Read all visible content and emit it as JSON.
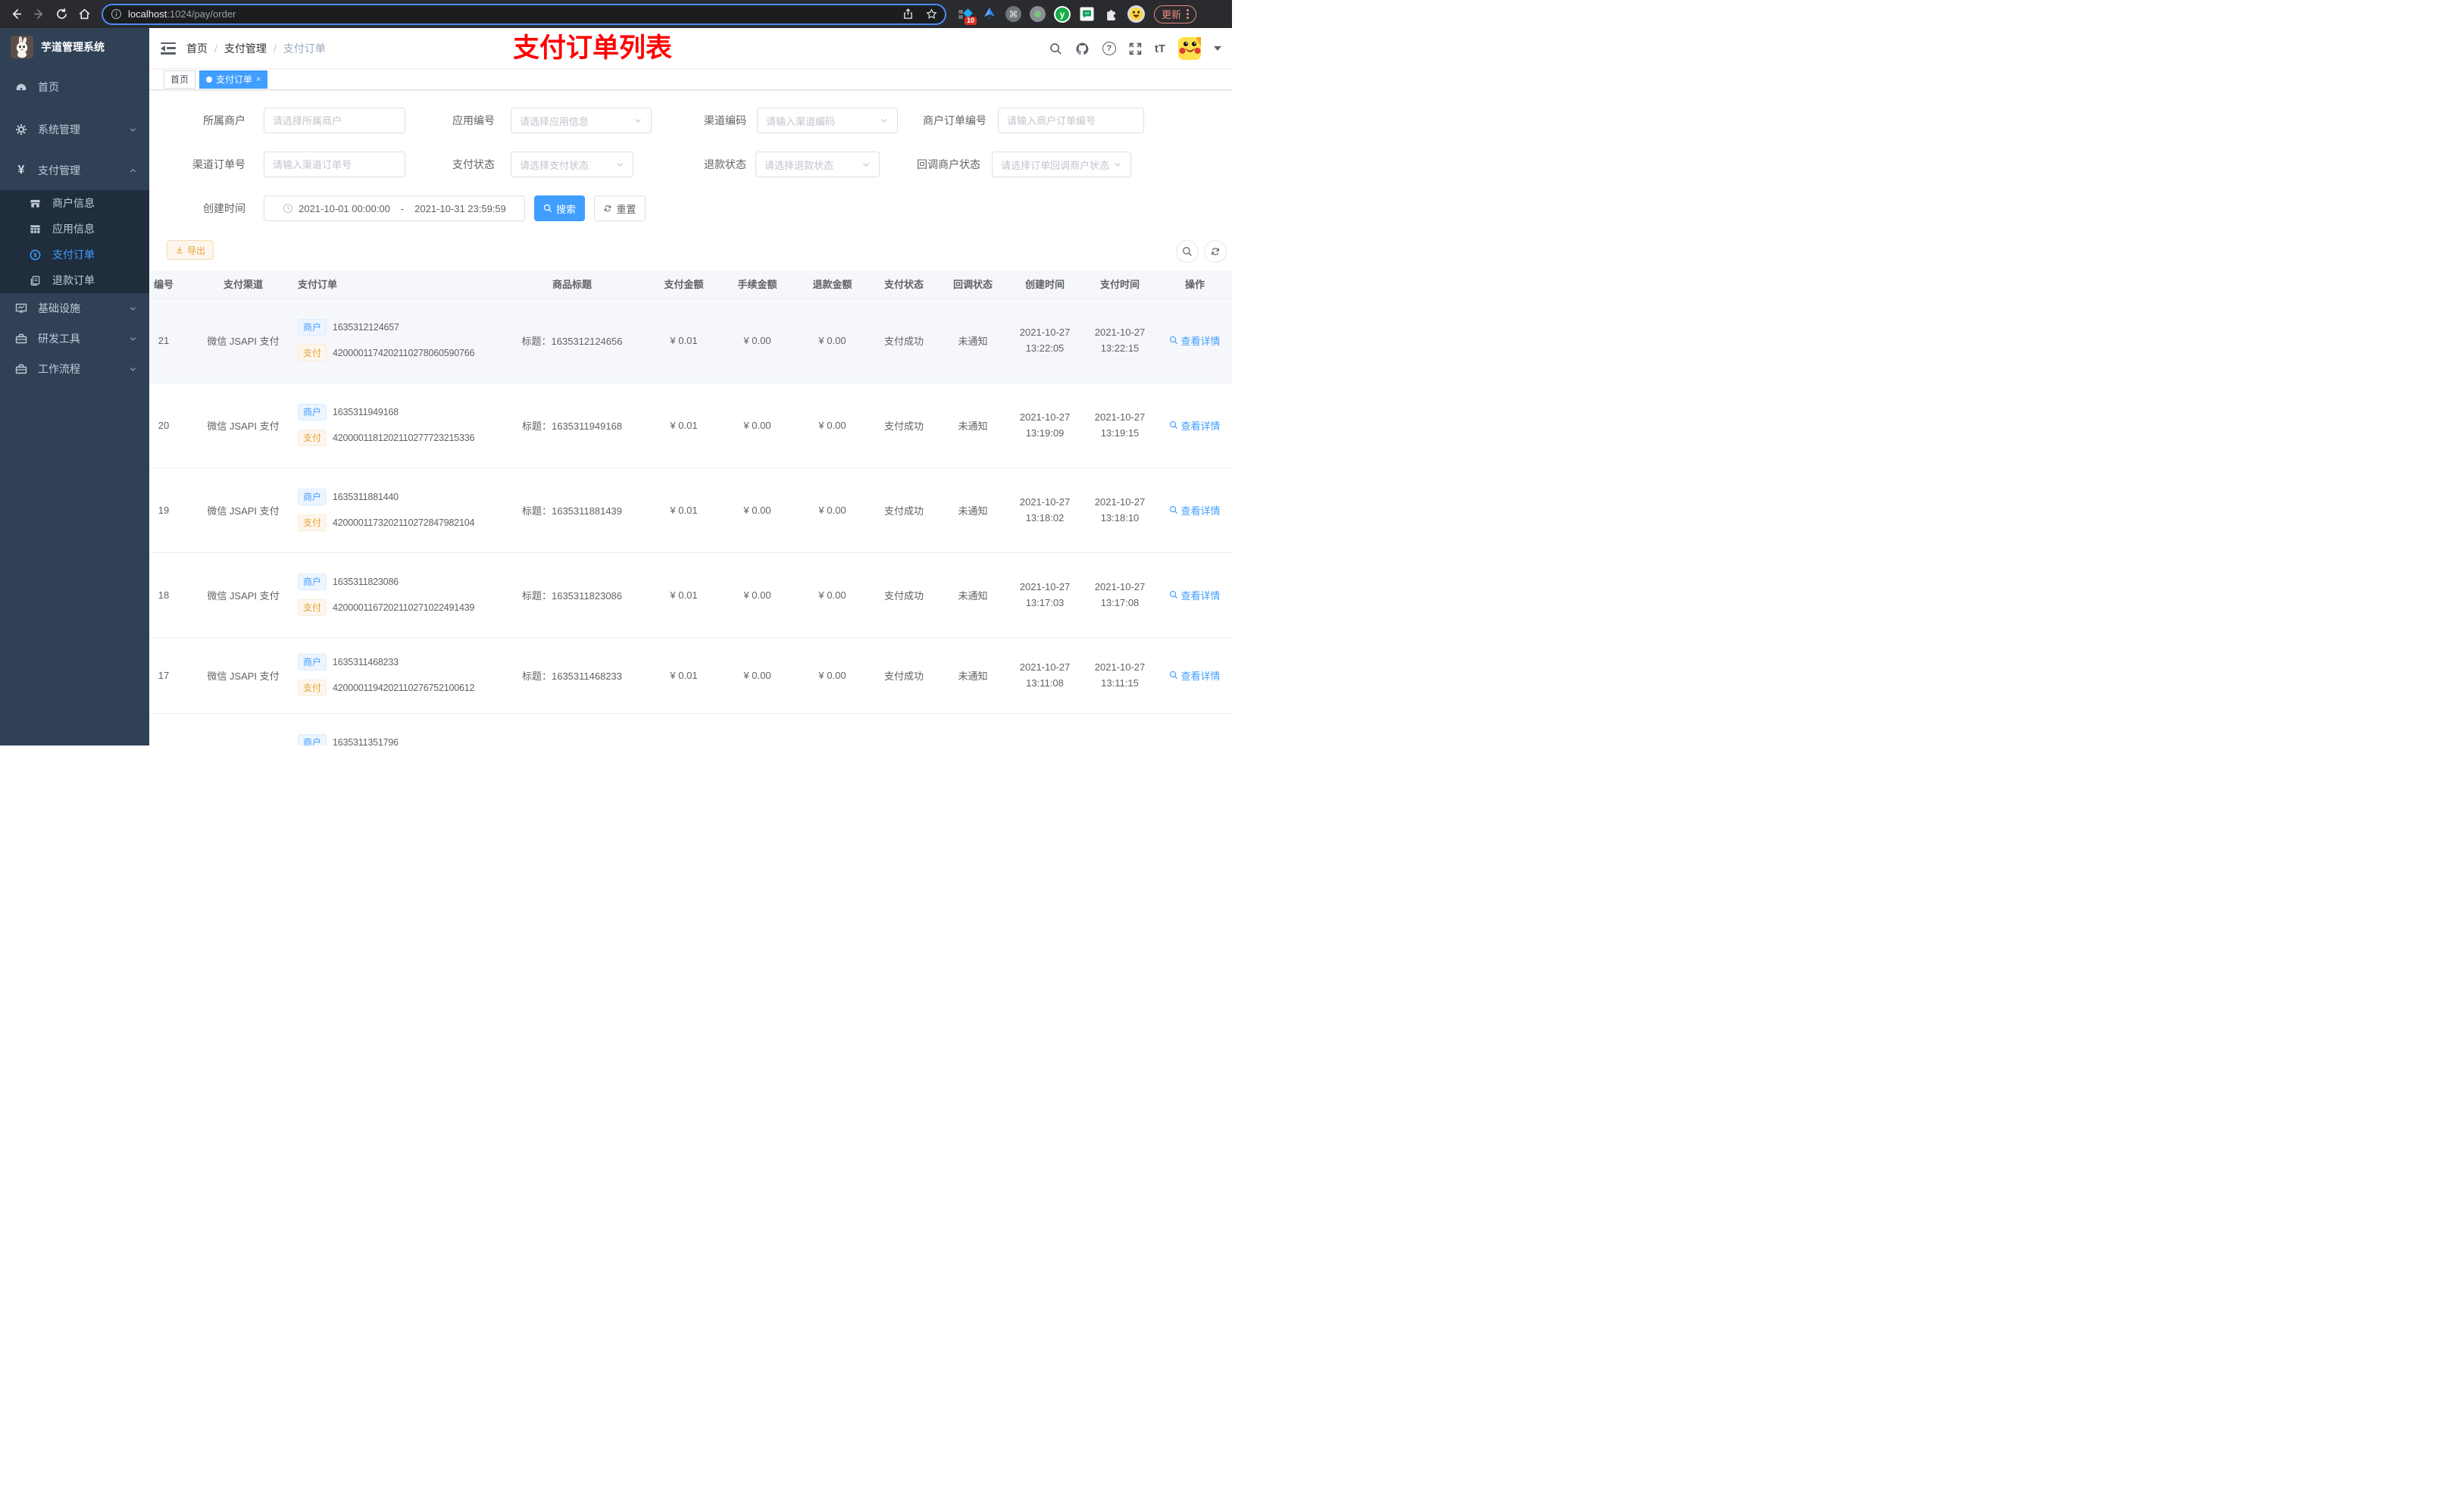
{
  "browser": {
    "url_host": "localhost",
    "url_rest": ":1024/pay/order",
    "ext_badge": "10",
    "update_label": "更新"
  },
  "glyphs": {
    "close_glyph": "×",
    "help_glyph": "?",
    "fontsize_glyph": "tT",
    "cmd_glyph": "⌘",
    "y_glyph": "y"
  },
  "sidebar": {
    "title": "芋道管理系统",
    "items": [
      {
        "label": "首页"
      },
      {
        "label": "系统管理"
      },
      {
        "label": "支付管理"
      },
      {
        "label": "商户信息"
      },
      {
        "label": "应用信息"
      },
      {
        "label": "支付订单"
      },
      {
        "label": "退款订单"
      },
      {
        "label": "基础设施"
      },
      {
        "label": "研发工具"
      },
      {
        "label": "工作流程"
      }
    ]
  },
  "navbar": {
    "breadcrumb": [
      "首页",
      "支付管理",
      "支付订单"
    ],
    "separator": "/",
    "overlay_title": "支付订单列表"
  },
  "tabs": [
    {
      "label": "首页"
    },
    {
      "label": "支付订单"
    }
  ],
  "filters": {
    "fields": [
      {
        "label": "所属商户",
        "placeholder": "请选择所属商户"
      },
      {
        "label": "应用编号",
        "placeholder": "请选择应用信息"
      },
      {
        "label": "渠道编码",
        "placeholder": "请输入渠道编码"
      },
      {
        "label": "商户订单编号",
        "placeholder": "请输入商户订单编号"
      },
      {
        "label": "渠道订单号",
        "placeholder": "请输入渠道订单号"
      },
      {
        "label": "支付状态",
        "placeholder": "请选择支付状态"
      },
      {
        "label": "退款状态",
        "placeholder": "请选择退款状态"
      },
      {
        "label": "回调商户状态",
        "placeholder": "请选择订单回调商户状态"
      }
    ],
    "time_label": "创建时间",
    "time_start": "2021-10-01 00:00:00",
    "time_separator": "-",
    "time_end": "2021-10-31 23:59:59",
    "search_label": "搜索",
    "reset_label": "重置"
  },
  "toolbar": {
    "export_label": "导出"
  },
  "table": {
    "columns": [
      "编号",
      "支付渠道",
      "支付订单",
      "商品标题",
      "支付金额",
      "手续金额",
      "退款金额",
      "支付状态",
      "回调状态",
      "创建时间",
      "支付时间",
      "操作"
    ],
    "merchant_tag": "商户",
    "pay_tag": "支付",
    "title_prefix": "标题：",
    "action_label": "查看详情",
    "rows": [
      {
        "id": "21",
        "channel": "微信 JSAPI 支付",
        "merchant_no": "1635312124657",
        "pay_no": "4200001174202110278060590766",
        "title": "1635312124656",
        "amount": "¥ 0.01",
        "fee": "¥ 0.00",
        "refund": "¥ 0.00",
        "status": "支付成功",
        "notify": "未通知",
        "create_date": "2021-10-27",
        "create_time": "13:22:05",
        "pay_date": "2021-10-27",
        "pay_time": "13:22:15"
      },
      {
        "id": "20",
        "channel": "微信 JSAPI 支付",
        "merchant_no": "1635311949168",
        "pay_no": "4200001181202110277723215336",
        "title": "1635311949168",
        "amount": "¥ 0.01",
        "fee": "¥ 0.00",
        "refund": "¥ 0.00",
        "status": "支付成功",
        "notify": "未通知",
        "create_date": "2021-10-27",
        "create_time": "13:19:09",
        "pay_date": "2021-10-27",
        "pay_time": "13:19:15"
      },
      {
        "id": "19",
        "channel": "微信 JSAPI 支付",
        "merchant_no": "1635311881440",
        "pay_no": "4200001173202110272847982104",
        "title": "1635311881439",
        "amount": "¥ 0.01",
        "fee": "¥ 0.00",
        "refund": "¥ 0.00",
        "status": "支付成功",
        "notify": "未通知",
        "create_date": "2021-10-27",
        "create_time": "13:18:02",
        "pay_date": "2021-10-27",
        "pay_time": "13:18:10"
      },
      {
        "id": "18",
        "channel": "微信 JSAPI 支付",
        "merchant_no": "1635311823086",
        "pay_no": "4200001167202110271022491439",
        "title": "1635311823086",
        "amount": "¥ 0.01",
        "fee": "¥ 0.00",
        "refund": "¥ 0.00",
        "status": "支付成功",
        "notify": "未通知",
        "create_date": "2021-10-27",
        "create_time": "13:17:03",
        "pay_date": "2021-10-27",
        "pay_time": "13:17:08"
      },
      {
        "id": "17",
        "channel": "微信 JSAPI 支付",
        "merchant_no": "1635311468233",
        "pay_no": "4200001194202110276752100612",
        "title": "1635311468233",
        "amount": "¥ 0.01",
        "fee": "¥ 0.00",
        "refund": "¥ 0.00",
        "status": "支付成功",
        "notify": "未通知",
        "create_date": "2021-10-27",
        "create_time": "13:11:08",
        "pay_date": "2021-10-27",
        "pay_time": "13:11:15"
      },
      {
        "merchant_no": "1635311351796"
      }
    ]
  }
}
